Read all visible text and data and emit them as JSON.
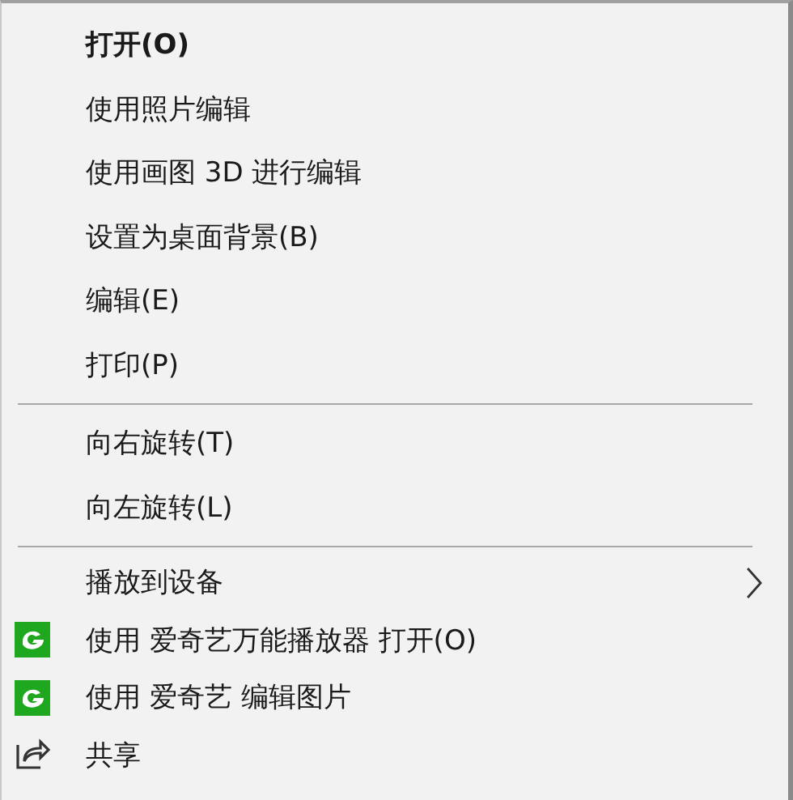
{
  "menu": {
    "items": [
      {
        "kind": "item",
        "label": "打开(O)",
        "default": true,
        "submenu": false
      },
      {
        "kind": "item",
        "label": "使用照片编辑",
        "default": false,
        "submenu": false
      },
      {
        "kind": "item",
        "label": "使用画图 3D 进行编辑",
        "default": false,
        "submenu": false
      },
      {
        "kind": "item",
        "label": "设置为桌面背景(B)",
        "default": false,
        "submenu": false
      },
      {
        "kind": "item",
        "label": "编辑(E)",
        "default": false,
        "submenu": false
      },
      {
        "kind": "item",
        "label": "打印(P)",
        "default": false,
        "submenu": false
      },
      {
        "kind": "separator"
      },
      {
        "kind": "item",
        "label": "向右旋转(T)",
        "default": false,
        "submenu": false
      },
      {
        "kind": "item",
        "label": "向左旋转(L)",
        "default": false,
        "submenu": false
      },
      {
        "kind": "separator"
      },
      {
        "kind": "item",
        "label": "播放到设备",
        "default": false,
        "submenu": true
      },
      {
        "kind": "app",
        "label": "使用 爱奇艺万能播放器 打开(O)",
        "default": false,
        "submenu": false
      },
      {
        "kind": "app",
        "label": "使用 爱奇艺 编辑图片",
        "default": false,
        "submenu": false
      },
      {
        "kind": "share",
        "label": "共享",
        "default": false,
        "submenu": false
      }
    ]
  }
}
